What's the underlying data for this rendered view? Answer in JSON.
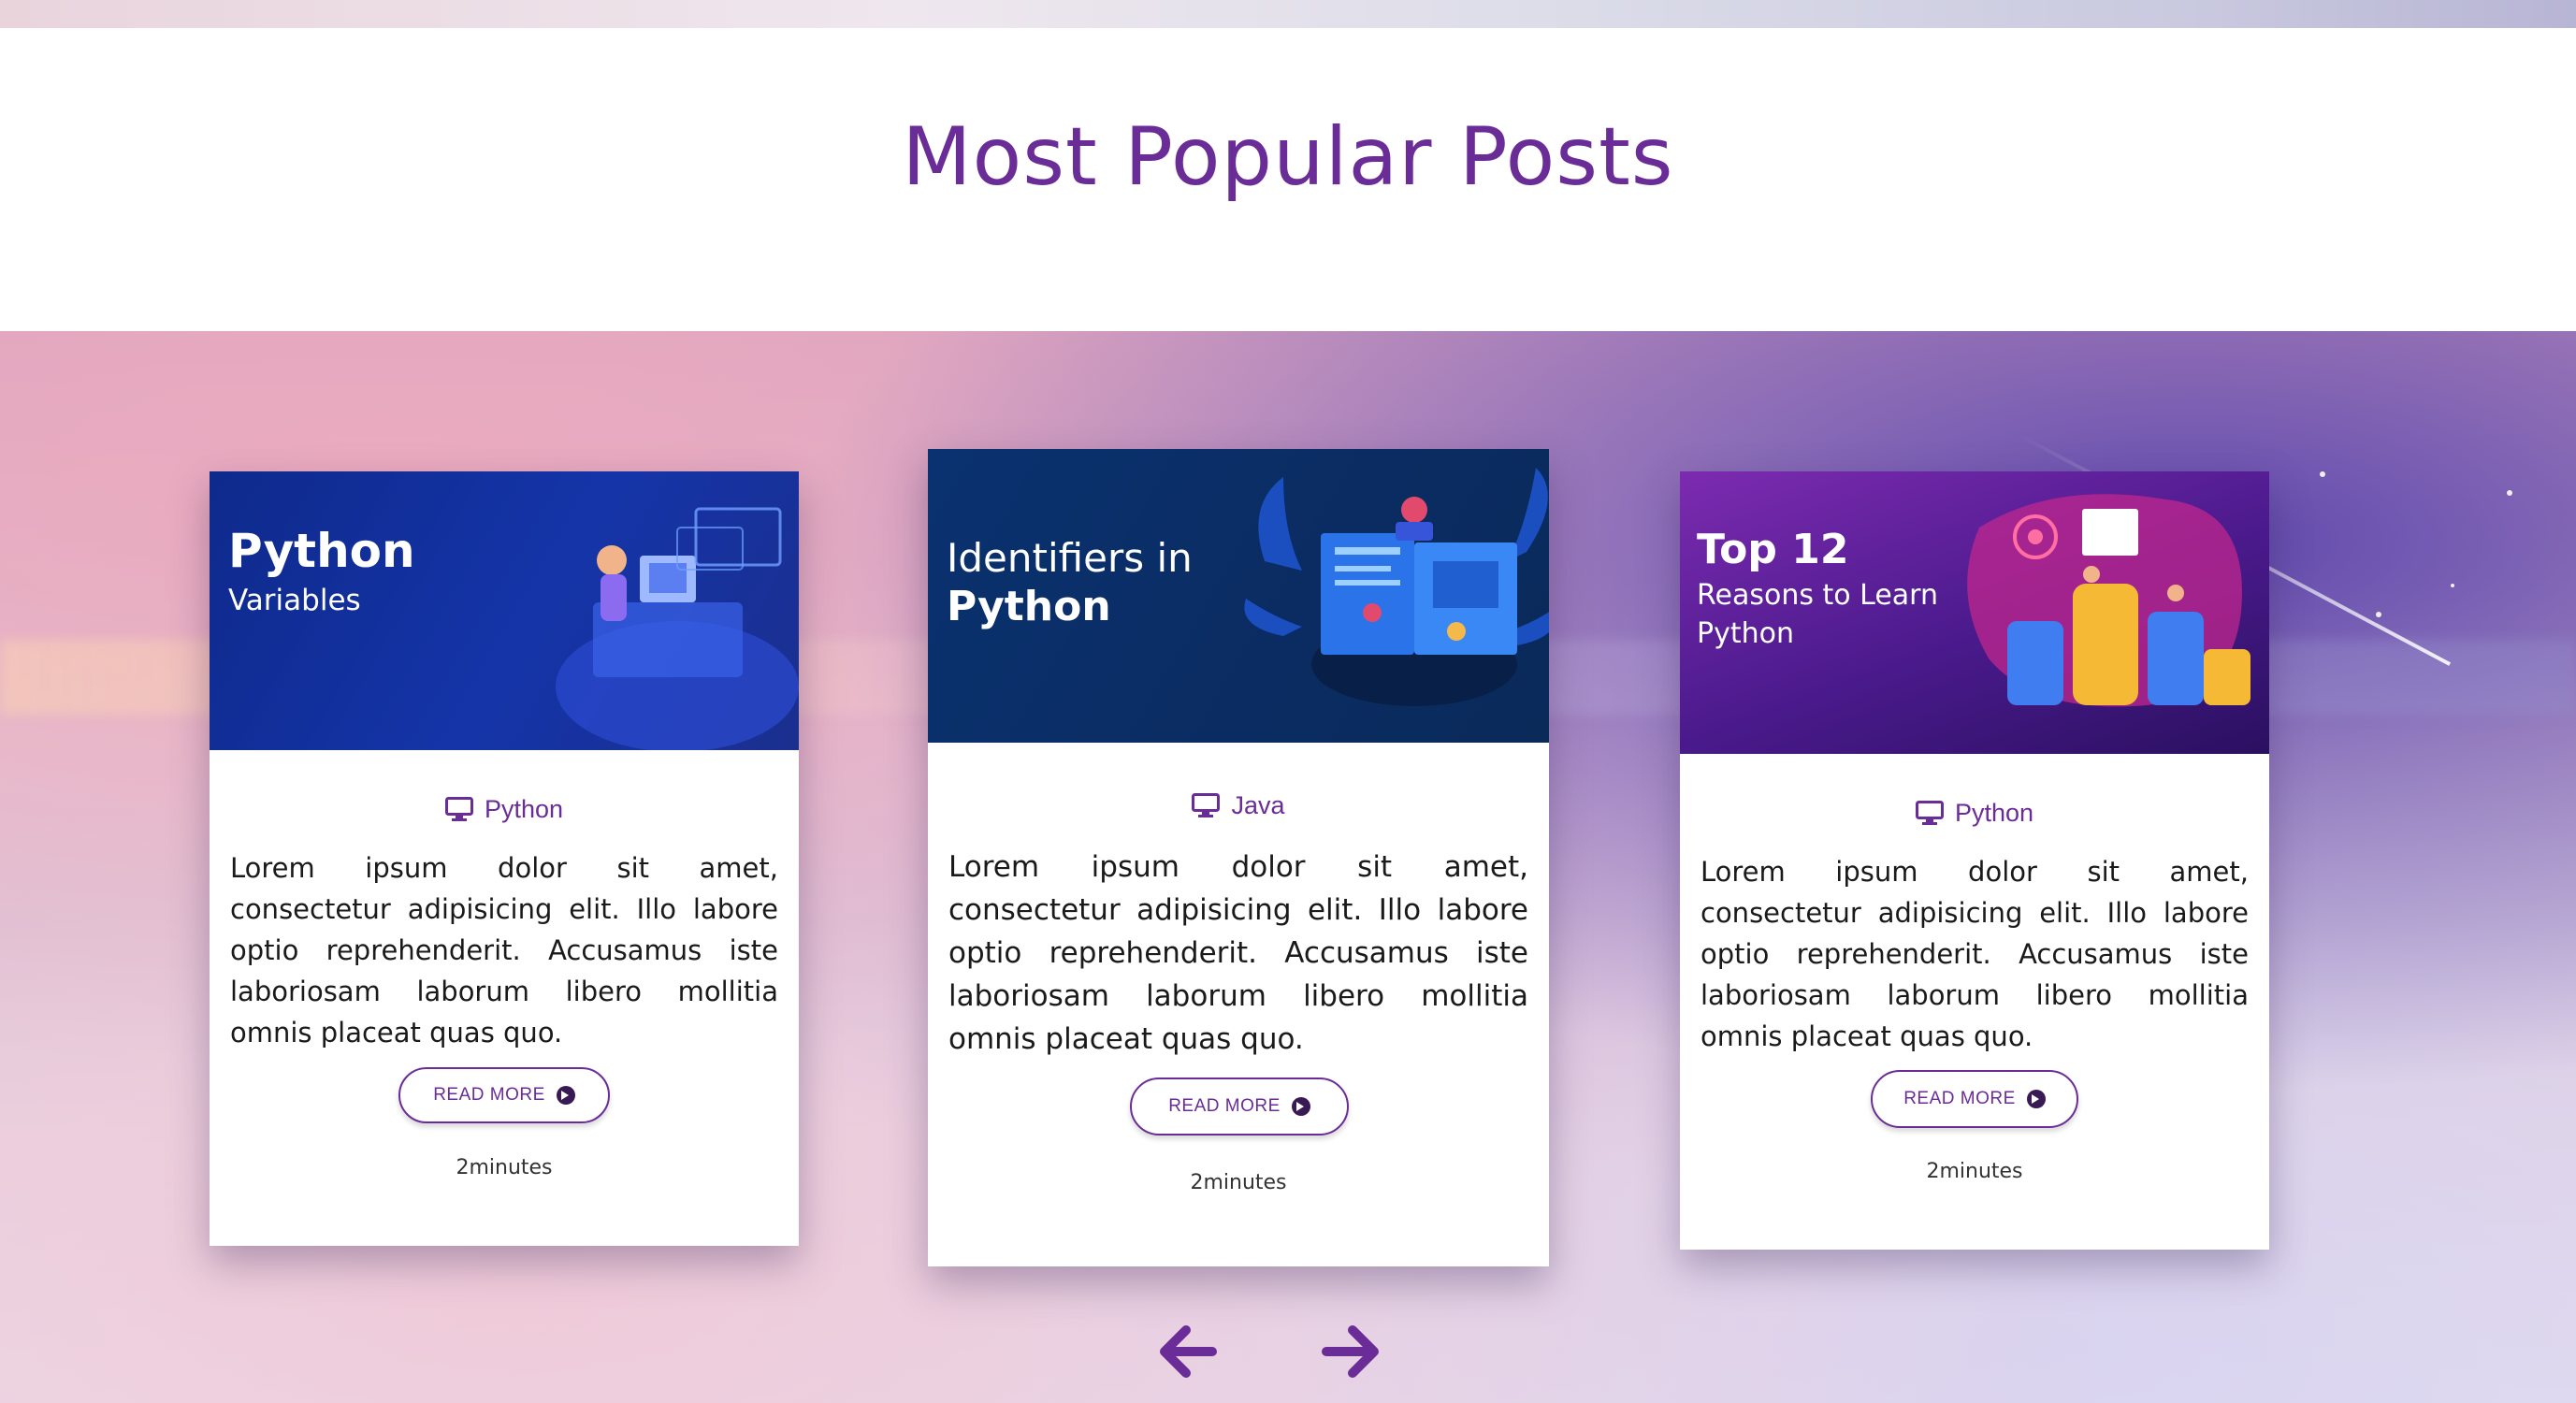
{
  "section": {
    "title": "Most Popular Posts"
  },
  "cards": [
    {
      "banner_line1": "Python",
      "banner_line2": "Variables",
      "category": "Python",
      "category_icon": "monitor-icon",
      "excerpt": "Lorem ipsum dolor sit amet, consectetur adipisicing elit. Illo labore optio reprehenderit. Accusamus iste laboriosam laborum libero mollitia omnis placeat quas quo.",
      "read_more": "READ MORE",
      "duration": "2minutes"
    },
    {
      "banner_line1": "Identifiers in",
      "banner_line2": "Python",
      "category": "Java",
      "category_icon": "monitor-icon",
      "excerpt": "Lorem ipsum dolor sit amet, consectetur adipisicing elit. Illo labore optio reprehenderit. Accusamus iste laboriosam laborum libero mollitia omnis placeat quas quo.",
      "read_more": "READ MORE",
      "duration": "2minutes"
    },
    {
      "banner_line1": "Top 12",
      "banner_line2": "Reasons to Learn",
      "banner_line3": "Python",
      "category": "Python",
      "category_icon": "monitor-icon",
      "excerpt": "Lorem ipsum dolor sit amet, consectetur adipisicing elit. Illo labore optio reprehenderit. Accusamus iste laboriosam laborum libero mollitia omnis placeat quas quo.",
      "read_more": "READ MORE",
      "duration": "2minutes"
    }
  ],
  "navigation": {
    "prev_icon": "arrow-left-icon",
    "next_icon": "arrow-right-icon"
  },
  "colors": {
    "accent": "#6a2d98",
    "card_bg": "#ffffff"
  }
}
